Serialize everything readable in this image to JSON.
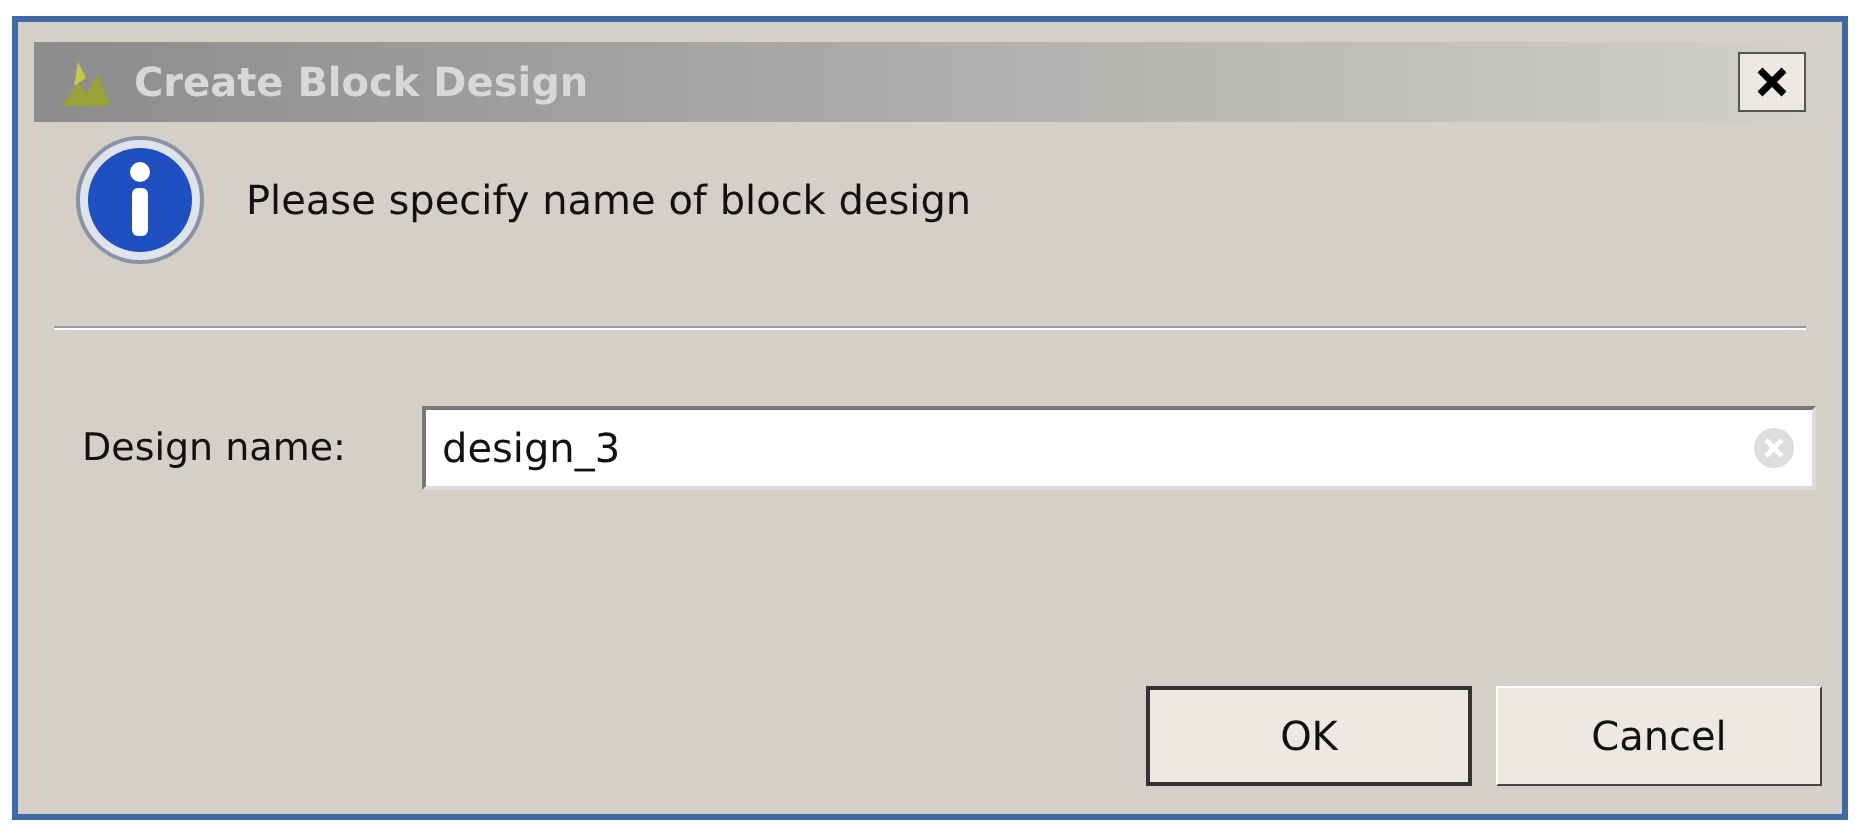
{
  "window": {
    "title": "Create Block Design"
  },
  "message": "Please specify name of block design",
  "field": {
    "label": "Design name:",
    "value": "design_3"
  },
  "buttons": [
    {
      "label": "OK",
      "default": true
    },
    {
      "label": "Cancel",
      "default": false
    }
  ]
}
